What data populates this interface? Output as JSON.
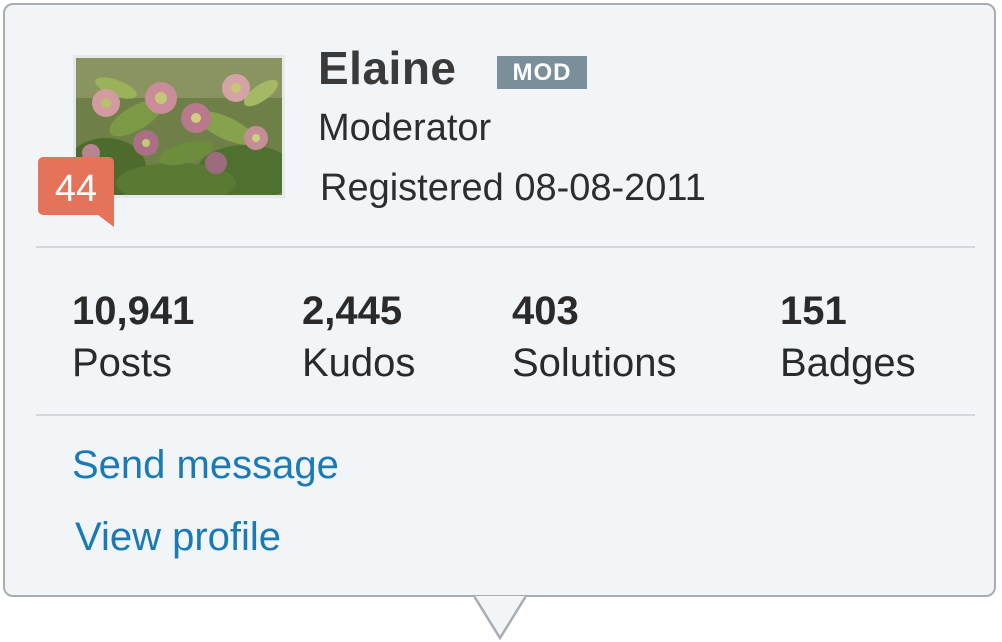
{
  "user": {
    "name": "Elaine",
    "badge": "MOD",
    "role": "Moderator",
    "registered": "Registered 08-08-2011",
    "rank": "44",
    "avatar_icon": "flower-photo"
  },
  "stats": [
    {
      "value": "10,941",
      "label": "Posts"
    },
    {
      "value": "2,445",
      "label": "Kudos"
    },
    {
      "value": "403",
      "label": "Solutions"
    },
    {
      "value": "151",
      "label": "Badges"
    }
  ],
  "actions": {
    "send_message": "Send message",
    "view_profile": "View profile"
  },
  "colors": {
    "card_bg": "#f2f5f8",
    "border": "#a9adb1",
    "link": "#1a7ab8",
    "mod_badge": "#7b8f9a",
    "rank_badge": "#e5735a"
  }
}
